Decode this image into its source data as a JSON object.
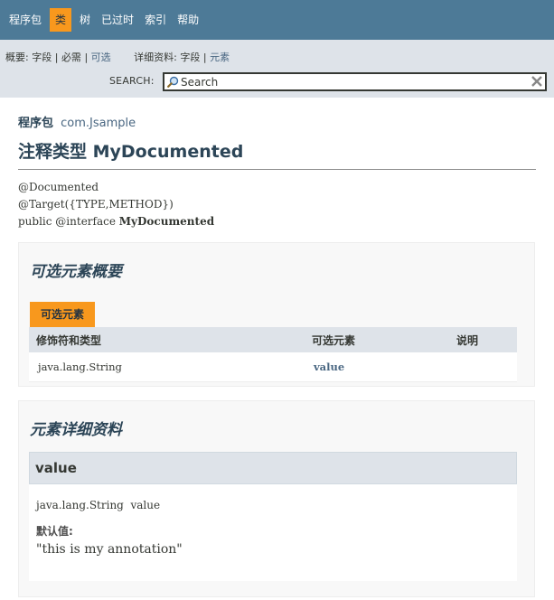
{
  "nav": {
    "items": [
      {
        "label": "程序包",
        "active": false
      },
      {
        "label": "类",
        "active": true
      },
      {
        "label": "树",
        "active": false
      },
      {
        "label": "已过时",
        "active": false
      },
      {
        "label": "索引",
        "active": false
      },
      {
        "label": "帮助",
        "active": false
      }
    ]
  },
  "subnav": {
    "summary_label": "概要:",
    "summary_field": "字段",
    "summary_required": "必需",
    "summary_optional": "可选",
    "detail_label": "详细资料:",
    "detail_field": "字段",
    "detail_element": "元素",
    "sep": "|"
  },
  "search": {
    "label": "SEARCH:",
    "placeholder": "Search",
    "search_icon": "magnifier-icon",
    "reset_icon": "reset-x-icon"
  },
  "header": {
    "package_label": "程序包",
    "package_name": "com.Jsample",
    "title": "注释类型 MyDocumented"
  },
  "signature": {
    "line1": "@Documented",
    "line2": "@Target({TYPE,METHOD})",
    "line3_prefix": "public @interface ",
    "line3_name": "MyDocumented"
  },
  "summary": {
    "title": "可选元素概要",
    "tab": "可选元素",
    "columns": [
      "修饰符和类型",
      "可选元素",
      "说明"
    ],
    "rows": [
      {
        "type": "java.lang.String",
        "element": "value",
        "description": ""
      }
    ]
  },
  "detail": {
    "title": "元素详细资料",
    "element_name": "value",
    "signature": "java.lang.String  value",
    "default_label": "默认值:",
    "default_value": "\"this is my annotation\""
  },
  "colors": {
    "nav_bg": "#4d7a97",
    "active_tab": "#f8981d",
    "subnav_bg": "#dee3e9",
    "link": "#4a6782"
  }
}
